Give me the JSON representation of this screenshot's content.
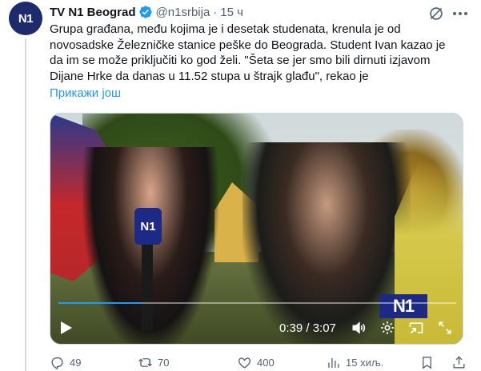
{
  "author": {
    "name": "TV N1 Beograd",
    "handle": "@n1srbija",
    "separator": "·",
    "time": "15 ч",
    "avatar_text": "N1"
  },
  "tweet": {
    "text": "Grupa građana, među kojima je i desetak studenata, krenula je od\nnovosadske Železničke stanice peške do Beograda. Student Ivan kazao je\nda im se može priključiti ko god želi. \"Šeta se jer smo bili dirnuti izjavom\nDijane Hrke da danas u 11.52 stupa u štrajk glađu\", rekao je",
    "show_more": "Прикажи још"
  },
  "video": {
    "mic_label": "N1",
    "logo_text": "N1",
    "current_time": "0:39",
    "duration": "3:07",
    "time_readout": "0:39 / 3:07",
    "progress": 0.208
  },
  "actions": {
    "replies": "49",
    "retweets": "70",
    "likes": "400",
    "views": "15 хиљ."
  },
  "colors": {
    "accent": "#1d9bf0",
    "verified": "#1d9bf0",
    "muted": "#536471",
    "n1_blue": "#1c2a86"
  },
  "icons": [
    "verified-icon",
    "grok-icon",
    "more-icon",
    "play-icon",
    "volume-icon",
    "settings-icon",
    "pip-icon",
    "fullscreen-icon",
    "reply-icon",
    "retweet-icon",
    "like-icon",
    "views-icon",
    "bookmark-icon",
    "share-icon"
  ]
}
